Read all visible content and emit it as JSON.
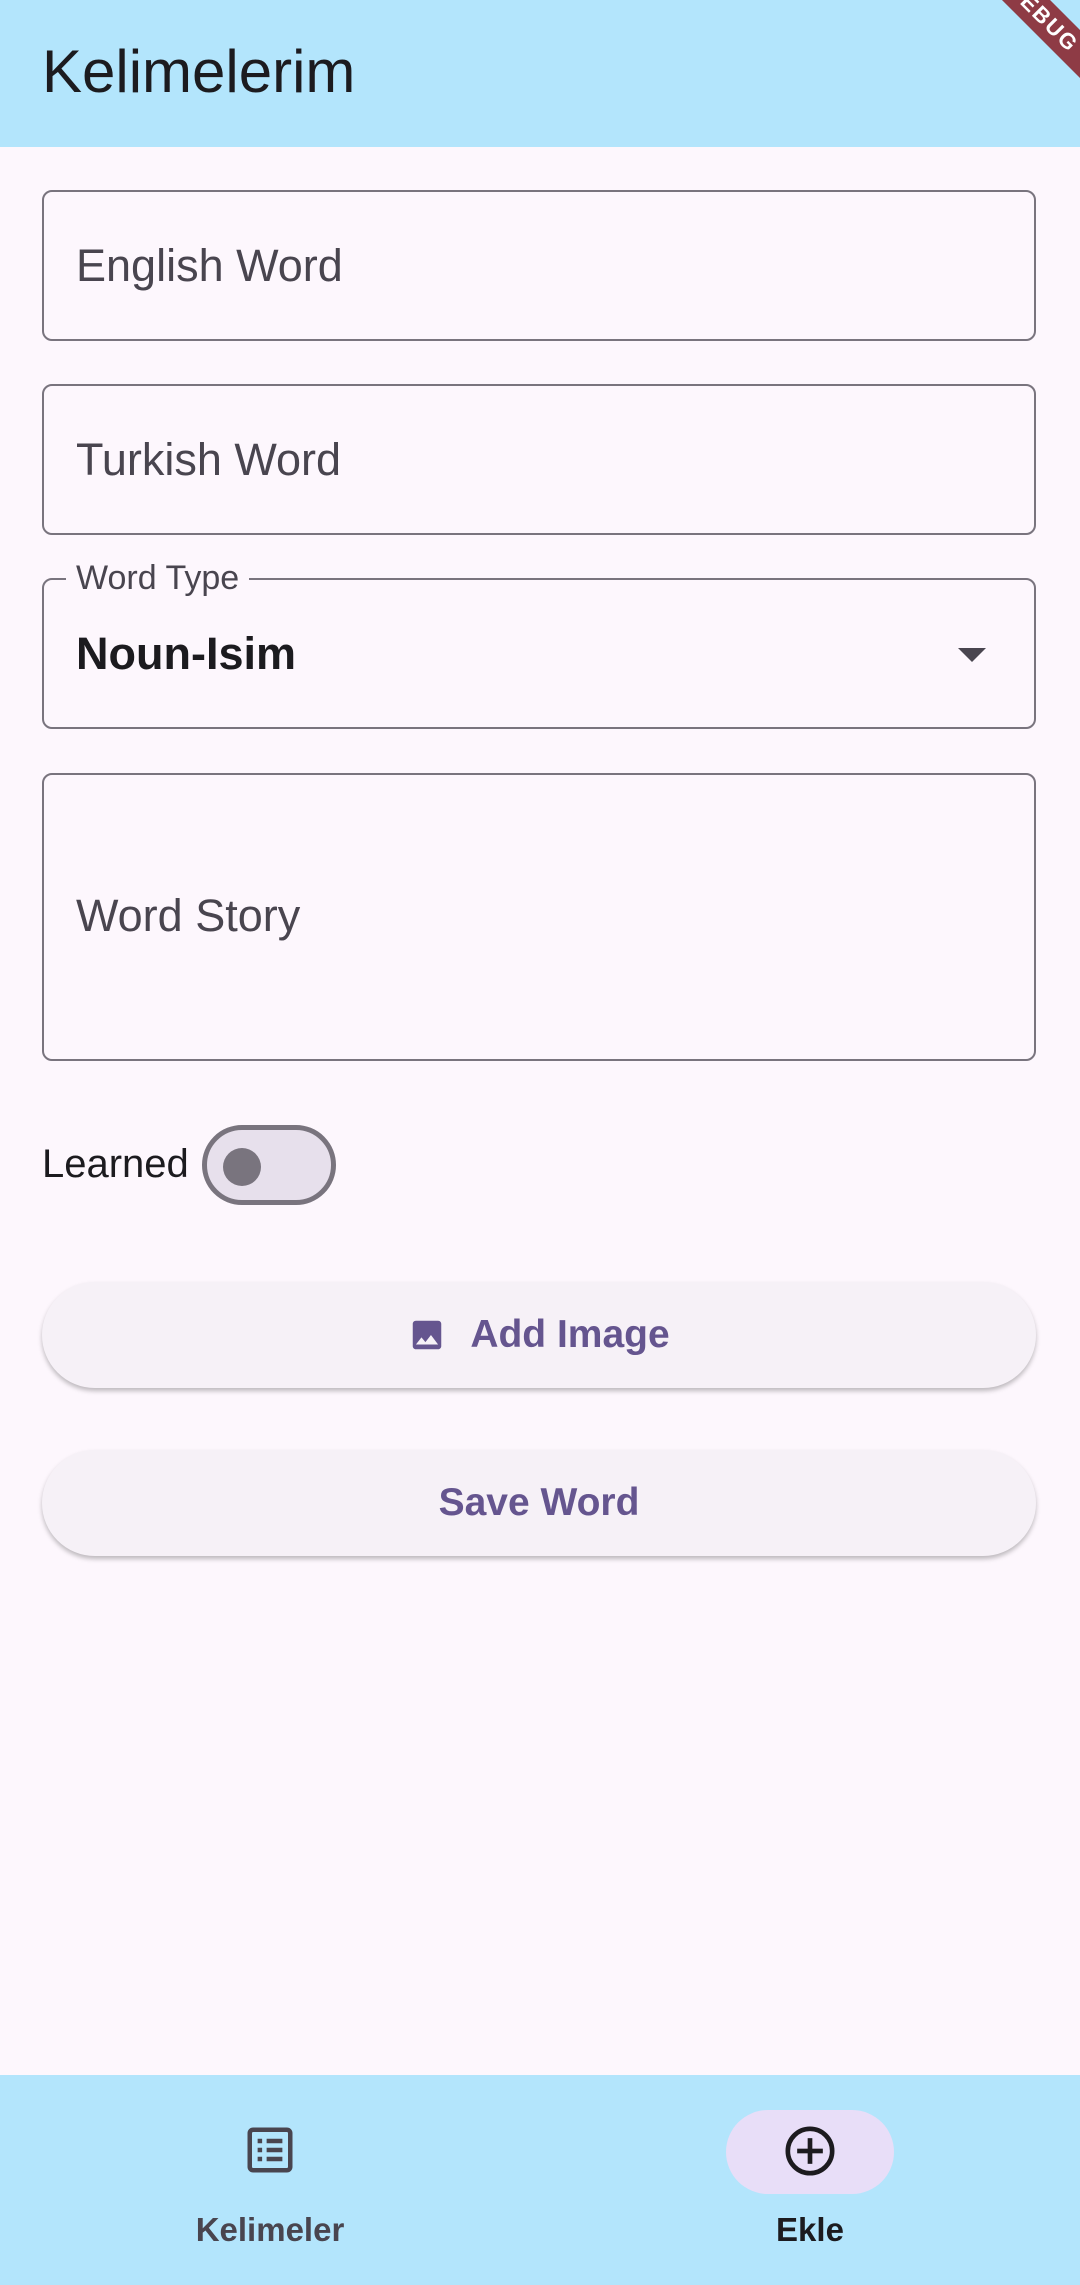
{
  "appbar": {
    "title": "Kelimelerim",
    "debug_banner": "DEBUG"
  },
  "form": {
    "english_word": {
      "placeholder": "English Word",
      "value": ""
    },
    "turkish_word": {
      "placeholder": "Turkish Word",
      "value": ""
    },
    "word_type": {
      "label": "Word Type",
      "selected": "Noun-Isim"
    },
    "word_story": {
      "placeholder": "Word Story",
      "value": ""
    },
    "learned": {
      "label": "Learned",
      "on": false
    },
    "add_image_label": "Add Image",
    "save_label": "Save Word"
  },
  "bottom_nav": {
    "items": [
      {
        "label": "Kelimeler",
        "icon": "list-icon",
        "active": false
      },
      {
        "label": "Ekle",
        "icon": "add-circle-icon",
        "active": true
      }
    ]
  },
  "colors": {
    "appbar_bg": "#b3e5fc",
    "page_bg": "#fdf7fd",
    "accent": "#65558f",
    "active_pill": "#e8def8"
  }
}
